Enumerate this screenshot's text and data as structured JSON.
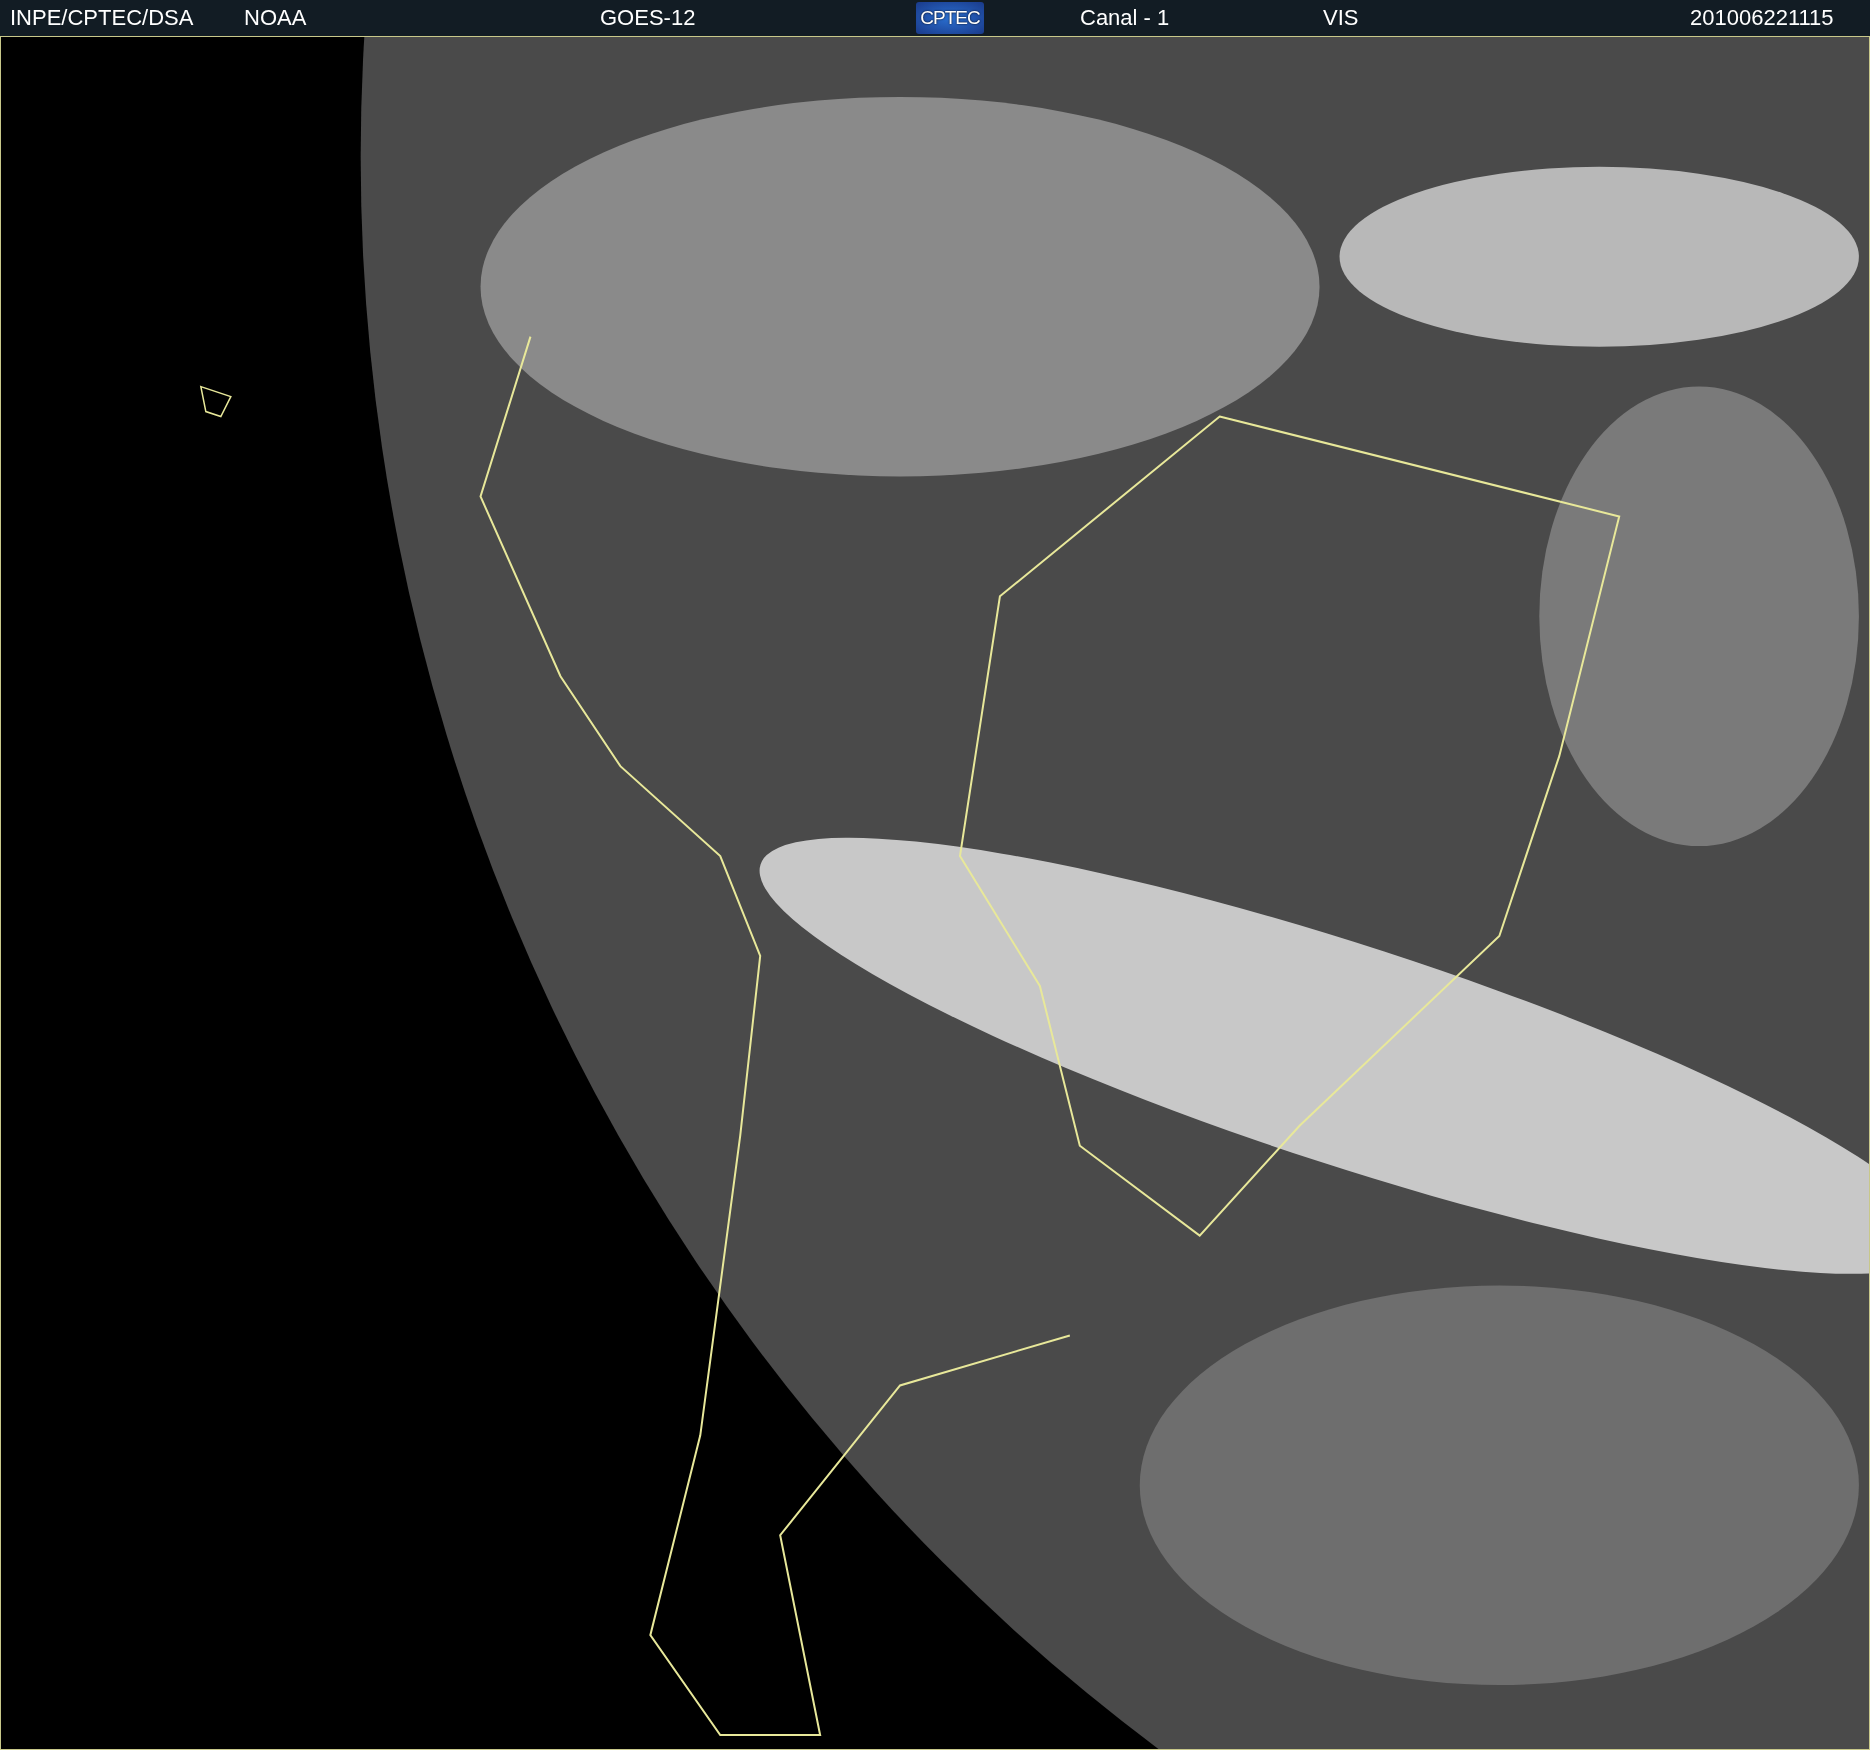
{
  "header": {
    "items": [
      {
        "kind": "text",
        "text": "INPE/CPTEC/DSA"
      },
      {
        "kind": "text",
        "text": "NOAA"
      },
      {
        "kind": "text",
        "text": "GOES-12"
      },
      {
        "kind": "logo",
        "text": "CPTEC"
      },
      {
        "kind": "text",
        "text": "Canal - 1"
      },
      {
        "kind": "text",
        "text": "VIS"
      },
      {
        "kind": "text",
        "text": "201006221115"
      }
    ]
  }
}
